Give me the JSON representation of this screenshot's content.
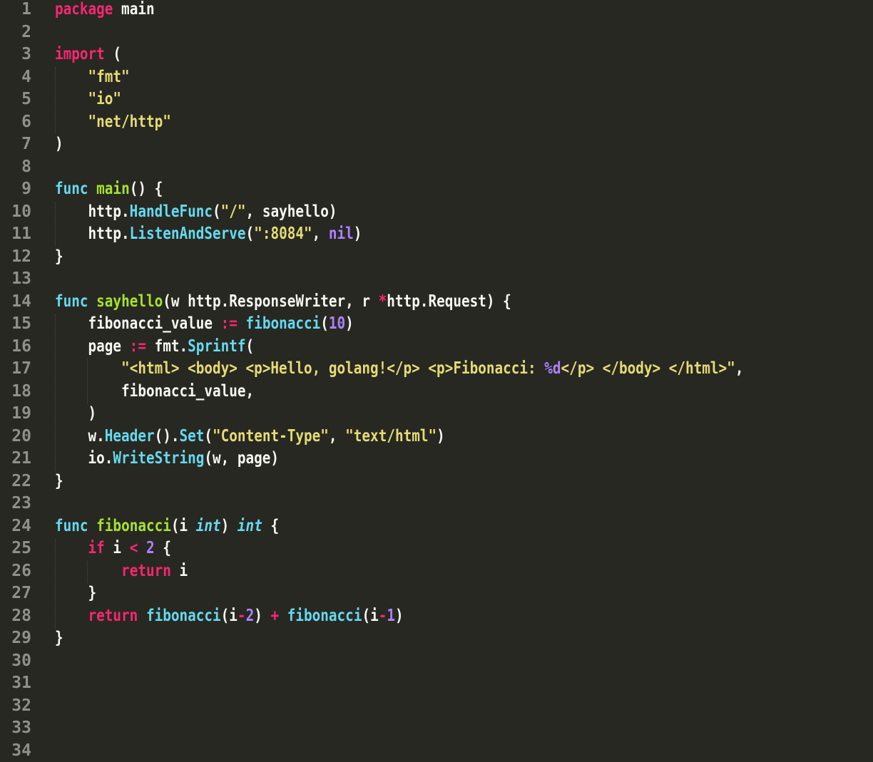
{
  "editor": {
    "language": "go",
    "theme_colors": {
      "background": "#272822",
      "gutter_text": "#90908a",
      "keyword": "#f92672",
      "function_name": "#a6e22e",
      "call": "#66d9ef",
      "string": "#e6db74",
      "number": "#ae81ff",
      "text": "#f8f8f2"
    },
    "lines": [
      {
        "number": "1",
        "tokens": [
          {
            "t": "package",
            "c": "kw"
          },
          {
            "t": " main",
            "c": "plain"
          }
        ]
      },
      {
        "number": "2",
        "tokens": []
      },
      {
        "number": "3",
        "tokens": [
          {
            "t": "import",
            "c": "kw"
          },
          {
            "t": " (",
            "c": "plain"
          }
        ]
      },
      {
        "number": "4",
        "tokens": [
          {
            "t": "    ",
            "c": "plain"
          },
          {
            "t": "\"fmt\"",
            "c": "str"
          }
        ]
      },
      {
        "number": "5",
        "tokens": [
          {
            "t": "    ",
            "c": "plain"
          },
          {
            "t": "\"io\"",
            "c": "str"
          }
        ]
      },
      {
        "number": "6",
        "tokens": [
          {
            "t": "    ",
            "c": "plain"
          },
          {
            "t": "\"net/http\"",
            "c": "str"
          }
        ]
      },
      {
        "number": "7",
        "tokens": [
          {
            "t": ")",
            "c": "plain"
          }
        ]
      },
      {
        "number": "8",
        "tokens": []
      },
      {
        "number": "9",
        "tokens": [
          {
            "t": "func",
            "c": "call"
          },
          {
            "t": " ",
            "c": "plain"
          },
          {
            "t": "main",
            "c": "fn"
          },
          {
            "t": "() {",
            "c": "plain"
          }
        ]
      },
      {
        "number": "10",
        "tokens": [
          {
            "t": "    http.",
            "c": "plain"
          },
          {
            "t": "HandleFunc",
            "c": "call"
          },
          {
            "t": "(",
            "c": "plain"
          },
          {
            "t": "\"/\"",
            "c": "str"
          },
          {
            "t": ", sayhello)",
            "c": "plain"
          }
        ]
      },
      {
        "number": "11",
        "tokens": [
          {
            "t": "    http.",
            "c": "plain"
          },
          {
            "t": "ListenAndServe",
            "c": "call"
          },
          {
            "t": "(",
            "c": "plain"
          },
          {
            "t": "\":8084\"",
            "c": "str"
          },
          {
            "t": ", ",
            "c": "plain"
          },
          {
            "t": "nil",
            "c": "num"
          },
          {
            "t": ")",
            "c": "plain"
          }
        ]
      },
      {
        "number": "12",
        "tokens": [
          {
            "t": "}",
            "c": "plain"
          }
        ]
      },
      {
        "number": "13",
        "tokens": []
      },
      {
        "number": "14",
        "tokens": [
          {
            "t": "func",
            "c": "call"
          },
          {
            "t": " ",
            "c": "plain"
          },
          {
            "t": "sayhello",
            "c": "fn"
          },
          {
            "t": "(w http.ResponseWriter, r ",
            "c": "plain"
          },
          {
            "t": "*",
            "c": "kw"
          },
          {
            "t": "http.Request) {",
            "c": "plain"
          }
        ]
      },
      {
        "number": "15",
        "tokens": [
          {
            "t": "    fibonacci_value ",
            "c": "plain"
          },
          {
            "t": ":=",
            "c": "kw"
          },
          {
            "t": " ",
            "c": "plain"
          },
          {
            "t": "fibonacci",
            "c": "call"
          },
          {
            "t": "(",
            "c": "plain"
          },
          {
            "t": "10",
            "c": "num"
          },
          {
            "t": ")",
            "c": "plain"
          }
        ]
      },
      {
        "number": "16",
        "tokens": [
          {
            "t": "    page ",
            "c": "plain"
          },
          {
            "t": ":=",
            "c": "kw"
          },
          {
            "t": " fmt.",
            "c": "plain"
          },
          {
            "t": "Sprintf",
            "c": "call"
          },
          {
            "t": "(",
            "c": "plain"
          }
        ]
      },
      {
        "number": "17",
        "tokens": [
          {
            "t": "        ",
            "c": "plain"
          },
          {
            "t": "\"<html> <body> <p>Hello, golang!</p> <p>Fibonacci: ",
            "c": "str"
          },
          {
            "t": "%d",
            "c": "num"
          },
          {
            "t": "</p> </body> </html>\"",
            "c": "str"
          },
          {
            "t": ",",
            "c": "plain"
          }
        ]
      },
      {
        "number": "18",
        "tokens": [
          {
            "t": "        fibonacci_value,",
            "c": "plain"
          }
        ]
      },
      {
        "number": "19",
        "tokens": [
          {
            "t": "    )",
            "c": "plain"
          }
        ]
      },
      {
        "number": "20",
        "tokens": [
          {
            "t": "    w.",
            "c": "plain"
          },
          {
            "t": "Header",
            "c": "call"
          },
          {
            "t": "().",
            "c": "plain"
          },
          {
            "t": "Set",
            "c": "call"
          },
          {
            "t": "(",
            "c": "plain"
          },
          {
            "t": "\"Content-Type\"",
            "c": "str"
          },
          {
            "t": ", ",
            "c": "plain"
          },
          {
            "t": "\"text/html\"",
            "c": "str"
          },
          {
            "t": ")",
            "c": "plain"
          }
        ]
      },
      {
        "number": "21",
        "tokens": [
          {
            "t": "    io.",
            "c": "plain"
          },
          {
            "t": "WriteString",
            "c": "call"
          },
          {
            "t": "(w, page)",
            "c": "plain"
          }
        ]
      },
      {
        "number": "22",
        "tokens": [
          {
            "t": "}",
            "c": "plain"
          }
        ]
      },
      {
        "number": "23",
        "tokens": []
      },
      {
        "number": "24",
        "tokens": [
          {
            "t": "func",
            "c": "call"
          },
          {
            "t": " ",
            "c": "plain"
          },
          {
            "t": "fibonacci",
            "c": "fn"
          },
          {
            "t": "(i ",
            "c": "plain"
          },
          {
            "t": "int",
            "c": "type"
          },
          {
            "t": ") ",
            "c": "plain"
          },
          {
            "t": "int",
            "c": "type"
          },
          {
            "t": " {",
            "c": "plain"
          }
        ]
      },
      {
        "number": "25",
        "tokens": [
          {
            "t": "    ",
            "c": "plain"
          },
          {
            "t": "if",
            "c": "kw"
          },
          {
            "t": " i ",
            "c": "plain"
          },
          {
            "t": "<",
            "c": "kw"
          },
          {
            "t": " ",
            "c": "plain"
          },
          {
            "t": "2",
            "c": "num"
          },
          {
            "t": " {",
            "c": "plain"
          }
        ]
      },
      {
        "number": "26",
        "tokens": [
          {
            "t": "        ",
            "c": "plain"
          },
          {
            "t": "return",
            "c": "kw"
          },
          {
            "t": " i",
            "c": "plain"
          }
        ]
      },
      {
        "number": "27",
        "tokens": [
          {
            "t": "    }",
            "c": "plain"
          }
        ]
      },
      {
        "number": "28",
        "tokens": [
          {
            "t": "    ",
            "c": "plain"
          },
          {
            "t": "return",
            "c": "kw"
          },
          {
            "t": " ",
            "c": "plain"
          },
          {
            "t": "fibonacci",
            "c": "call"
          },
          {
            "t": "(i",
            "c": "plain"
          },
          {
            "t": "-",
            "c": "kw"
          },
          {
            "t": "2",
            "c": "num"
          },
          {
            "t": ") ",
            "c": "plain"
          },
          {
            "t": "+",
            "c": "kw"
          },
          {
            "t": " ",
            "c": "plain"
          },
          {
            "t": "fibonacci",
            "c": "call"
          },
          {
            "t": "(i",
            "c": "plain"
          },
          {
            "t": "-",
            "c": "kw"
          },
          {
            "t": "1",
            "c": "num"
          },
          {
            "t": ")",
            "c": "plain"
          }
        ]
      },
      {
        "number": "29",
        "tokens": [
          {
            "t": "}",
            "c": "plain"
          }
        ]
      },
      {
        "number": "30",
        "tokens": []
      },
      {
        "number": "31",
        "tokens": []
      },
      {
        "number": "32",
        "tokens": []
      },
      {
        "number": "33",
        "tokens": []
      },
      {
        "number": "34",
        "tokens": []
      }
    ]
  }
}
